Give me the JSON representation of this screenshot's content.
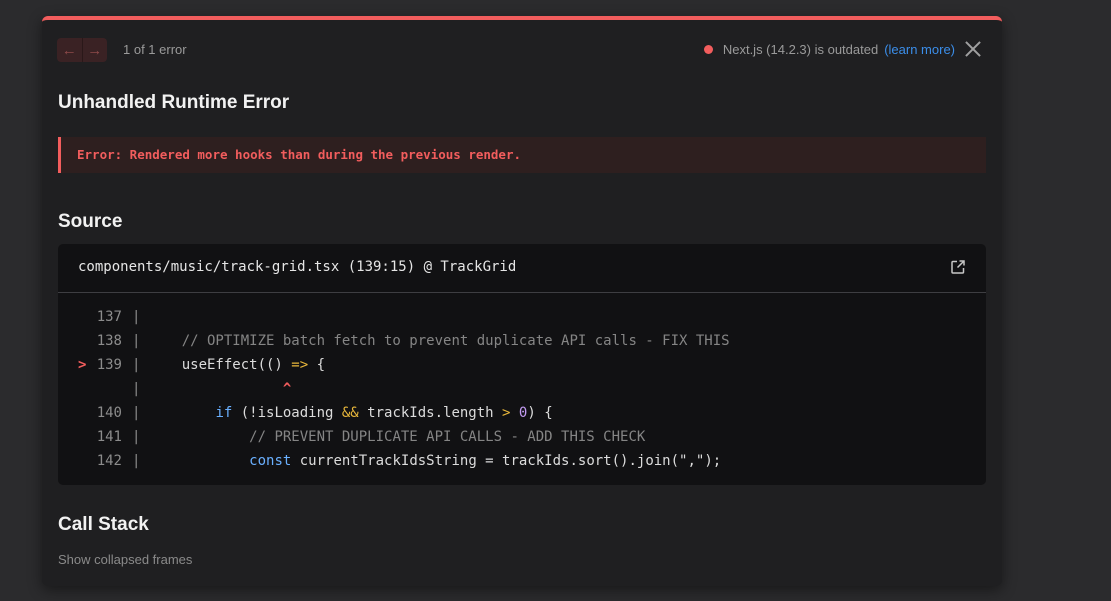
{
  "header": {
    "prev_icon": "arrow-left-icon",
    "next_icon": "arrow-right-icon",
    "error_count": "1 of 1 error",
    "version_text": "Next.js (14.2.3) is outdated",
    "learn_more": "(learn more)",
    "close_icon": "close-icon"
  },
  "title": "Unhandled Runtime Error",
  "error_message": "Error: Rendered more hooks than during the previous render.",
  "source": {
    "heading": "Source",
    "file": "components/music/track-grid.tsx (139:15) @ TrackGrid",
    "open_icon": "external-link-icon",
    "lines": [
      {
        "num": "137",
        "marker": "",
        "bar": "|",
        "text": ""
      },
      {
        "num": "138",
        "marker": "",
        "bar": "|",
        "text": "    // OPTIMIZE batch fetch to prevent duplicate API calls - FIX THIS"
      },
      {
        "num": "139",
        "marker": ">",
        "bar": "|",
        "text": "    useEffect(() => {"
      },
      {
        "num": "",
        "marker": "",
        "bar": "|",
        "text": "                ^"
      },
      {
        "num": "140",
        "marker": "",
        "bar": "|",
        "text": "        if (!isLoading && trackIds.length > 0) {"
      },
      {
        "num": "141",
        "marker": "",
        "bar": "|",
        "text": "            // PREVENT DUPLICATE API CALLS - ADD THIS CHECK"
      },
      {
        "num": "142",
        "marker": "",
        "bar": "|",
        "text": "            const currentTrackIdsString = trackIds.sort().join(\",\");"
      }
    ]
  },
  "call_stack": {
    "heading": "Call Stack",
    "collapsed_label": "Show collapsed frames"
  },
  "colors": {
    "accent_red": "#f25d5d",
    "link_blue": "#3b8eea",
    "dialog_bg": "#1f1f21",
    "code_bg": "#111113"
  }
}
